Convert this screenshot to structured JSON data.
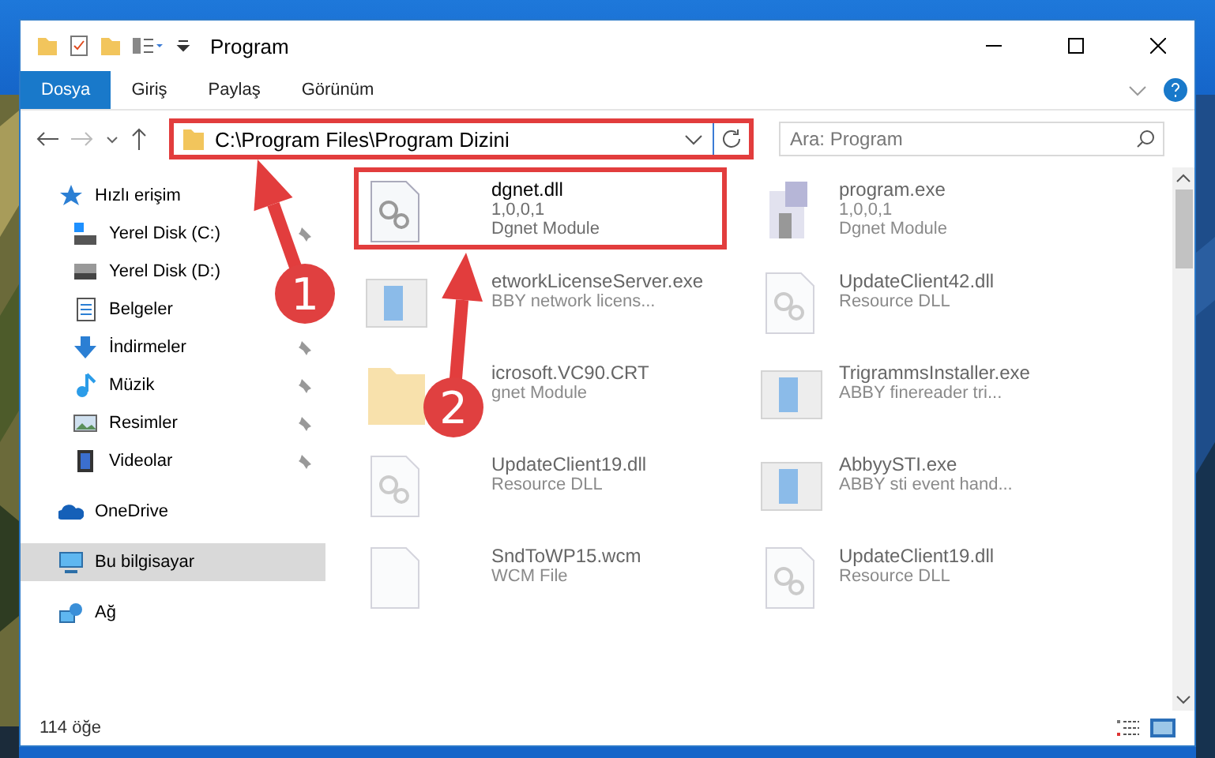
{
  "window": {
    "title": "Program"
  },
  "ribbon_tabs": [
    {
      "label": "Dosya",
      "selected": true
    },
    {
      "label": "Giriş",
      "selected": false
    },
    {
      "label": "Paylaş",
      "selected": false
    },
    {
      "label": "Görünüm",
      "selected": false
    }
  ],
  "address_bar": {
    "path": "C:\\Program Files\\Program Dizini",
    "highlighted": true
  },
  "search": {
    "placeholder": "Ara: Program"
  },
  "sidebar": {
    "items": [
      {
        "label": "Hızlı erişim",
        "kind": "star",
        "selected": false,
        "children": [
          {
            "label": "Yerel Disk (C:)",
            "kind": "windrive",
            "pinned": true
          },
          {
            "label": "Yerel Disk (D:)",
            "kind": "drive",
            "pinned": false
          },
          {
            "label": "Belgeler",
            "kind": "document",
            "pinned": false
          },
          {
            "label": "İndirmeler",
            "kind": "download",
            "pinned": true
          },
          {
            "label": "Müzik",
            "kind": "music",
            "pinned": true
          },
          {
            "label": "Resimler",
            "kind": "pictures",
            "pinned": true
          },
          {
            "label": "Videolar",
            "kind": "video",
            "pinned": true
          }
        ]
      },
      {
        "label": "OneDrive",
        "kind": "cloud",
        "selected": false
      },
      {
        "label": "Bu bilgisayar",
        "kind": "computer",
        "selected": true
      },
      {
        "label": "Ağ",
        "kind": "network",
        "selected": false
      }
    ]
  },
  "files": [
    {
      "name": "dgnet.dll",
      "lines": [
        "1,0,0,1",
        "Dgnet Module"
      ],
      "kind": "gears",
      "blurred": false,
      "highlighted": true
    },
    {
      "name": "program.exe",
      "lines": [
        "1,0,0,1",
        "Dgnet Module"
      ],
      "kind": "installer",
      "blurred": true,
      "highlighted": false
    },
    {
      "name": "etworkLicenseServer.exe",
      "lines": [
        "BBY network licens..."
      ],
      "kind": "app",
      "blurred": true,
      "highlighted": false
    },
    {
      "name": "UpdateClient42.dll",
      "lines": [
        "Resource DLL"
      ],
      "kind": "gears",
      "blurred": true,
      "highlighted": false
    },
    {
      "name": "icrosoft.VC90.CRT",
      "lines": [
        "gnet Module"
      ],
      "kind": "folder",
      "blurred": true,
      "highlighted": false
    },
    {
      "name": "TrigrammsInstaller.exe",
      "lines": [
        "ABBY finereader tri..."
      ],
      "kind": "app",
      "blurred": true,
      "highlighted": false
    },
    {
      "name": "UpdateClient19.dll",
      "lines": [
        "Resource DLL"
      ],
      "kind": "gears",
      "blurred": true,
      "highlighted": false
    },
    {
      "name": "AbbyySTI.exe",
      "lines": [
        "ABBY sti event hand..."
      ],
      "kind": "app",
      "blurred": true,
      "highlighted": false
    },
    {
      "name": "SndToWP15.wcm",
      "lines": [
        "WCM File"
      ],
      "kind": "blank",
      "blurred": true,
      "highlighted": false
    },
    {
      "name": "UpdateClient19.dll",
      "lines": [
        "Resource DLL"
      ],
      "kind": "gears",
      "blurred": true,
      "highlighted": false
    }
  ],
  "status_bar": {
    "count": "114 öğe"
  },
  "annotations": [
    {
      "number": "1"
    },
    {
      "number": "2"
    }
  ]
}
